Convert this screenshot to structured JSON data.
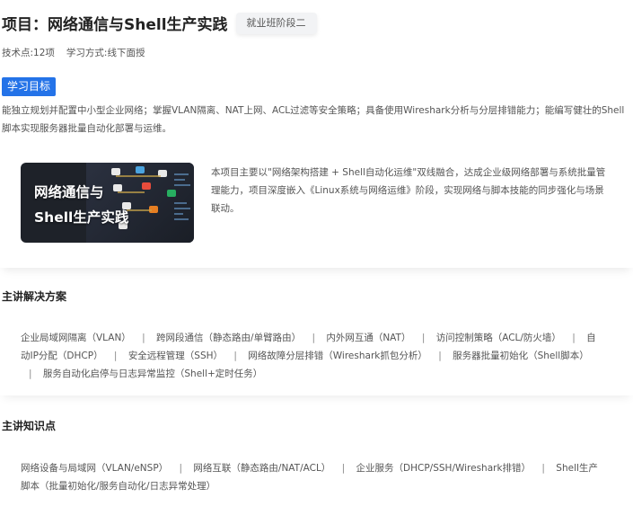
{
  "project": {
    "title": "项目：网络通信与Shell生产实践",
    "stage_badge": "就业班阶段二",
    "tech_points": "技术点:12项",
    "study_mode": "学习方式:线下面授"
  },
  "goal": {
    "tag": "学习目标",
    "text": "能独立规划并配置中小型企业网络；掌握VLAN隔离、NAT上网、ACL过滤等安全策略；具备使用Wireshark分析与分层排错能力；能编写健壮的Shell脚本实现服务器批量自动化部署与运维。"
  },
  "cover": {
    "line1": "网络通信与",
    "line2": "Shell生产实践"
  },
  "intro": {
    "text": "本项目主要以\"网络架构搭建 + Shell自动化运维\"双线融合，达成企业级网络部署与系统批量管理能力，项目深度嵌入《Linux系统与网络运维》阶段，实现网络与脚本技能的同步强化与场景联动。"
  },
  "solutions": {
    "title": "主讲解决方案",
    "separator": "|",
    "items": [
      "企业局域网隔离（VLAN）",
      "跨网段通信（静态路由/单臂路由）",
      "内外网互通（NAT）",
      "访问控制策略（ACL/防火墙）",
      "自动IP分配（DHCP）",
      "安全远程管理（SSH）",
      "网络故障分层排错（Wireshark抓包分析）",
      "服务器批量初始化（Shell脚本）",
      "服务自动化启停与日志异常监控（Shell+定时任务）"
    ]
  },
  "knowledge": {
    "title": "主讲知识点",
    "separator": "|",
    "items": [
      "网络设备与局域网（VLAN/eNSP）",
      "网络互联（静态路由/NAT/ACL）",
      "企业服务（DHCP/SSH/Wireshark排错）",
      "Shell生产脚本（批量初始化/服务自动化/日志异常处理）"
    ]
  },
  "colors": {
    "accent": "#2473e8",
    "badge_bg": "#f2f3f5",
    "text": "#555555"
  }
}
